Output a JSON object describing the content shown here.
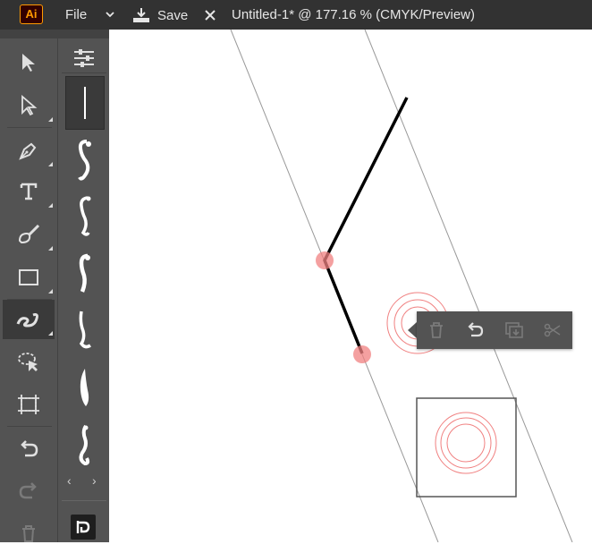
{
  "app": {
    "logo_text": "Ai"
  },
  "menubar": {
    "file_label": "File",
    "save_label": "Save",
    "document_title": "Untitled-1* @ 177.16 % (CMYK/Preview)"
  },
  "toolbar": {
    "tools": [
      {
        "name": "selection-tool",
        "icon": "arrow-cursor-icon",
        "active": false
      },
      {
        "name": "direct-selection-tool",
        "icon": "hollow-arrow-icon",
        "active": false
      },
      {
        "name": "pen-tool",
        "icon": "pen-icon",
        "active": false
      },
      {
        "name": "type-tool",
        "icon": "type-icon",
        "active": false
      },
      {
        "name": "brush-tool",
        "icon": "brush-icon",
        "active": false
      },
      {
        "name": "rectangle-tool",
        "icon": "rectangle-icon",
        "active": false
      },
      {
        "name": "shaper-tool",
        "icon": "scribble-icon",
        "active": true
      },
      {
        "name": "lasso-tool",
        "icon": "lasso-icon",
        "active": false
      },
      {
        "name": "artboard-tool",
        "icon": "artboard-icon",
        "active": false
      },
      {
        "name": "undo-tool",
        "icon": "undo-icon",
        "active": false
      },
      {
        "name": "redo-tool",
        "icon": "redo-icon",
        "active": false
      },
      {
        "name": "delete-tool",
        "icon": "trash-icon",
        "active": false
      }
    ]
  },
  "brush_panel": {
    "brushes": [
      "straight-line-brush",
      "swirl-brush-1",
      "swirl-brush-2",
      "swirl-brush-3",
      "swirl-brush-4",
      "swirl-brush-5",
      "swirl-brush-6"
    ],
    "nav_prev": "‹",
    "nav_next": "›"
  },
  "context_menu": {
    "actions": [
      "delete",
      "undo",
      "duplicate",
      "cut"
    ]
  },
  "colors": {
    "ui_dark": "#323232",
    "ui_panel": "#535353",
    "anchor": "#f08080",
    "logo_orange": "#ff9a00"
  }
}
